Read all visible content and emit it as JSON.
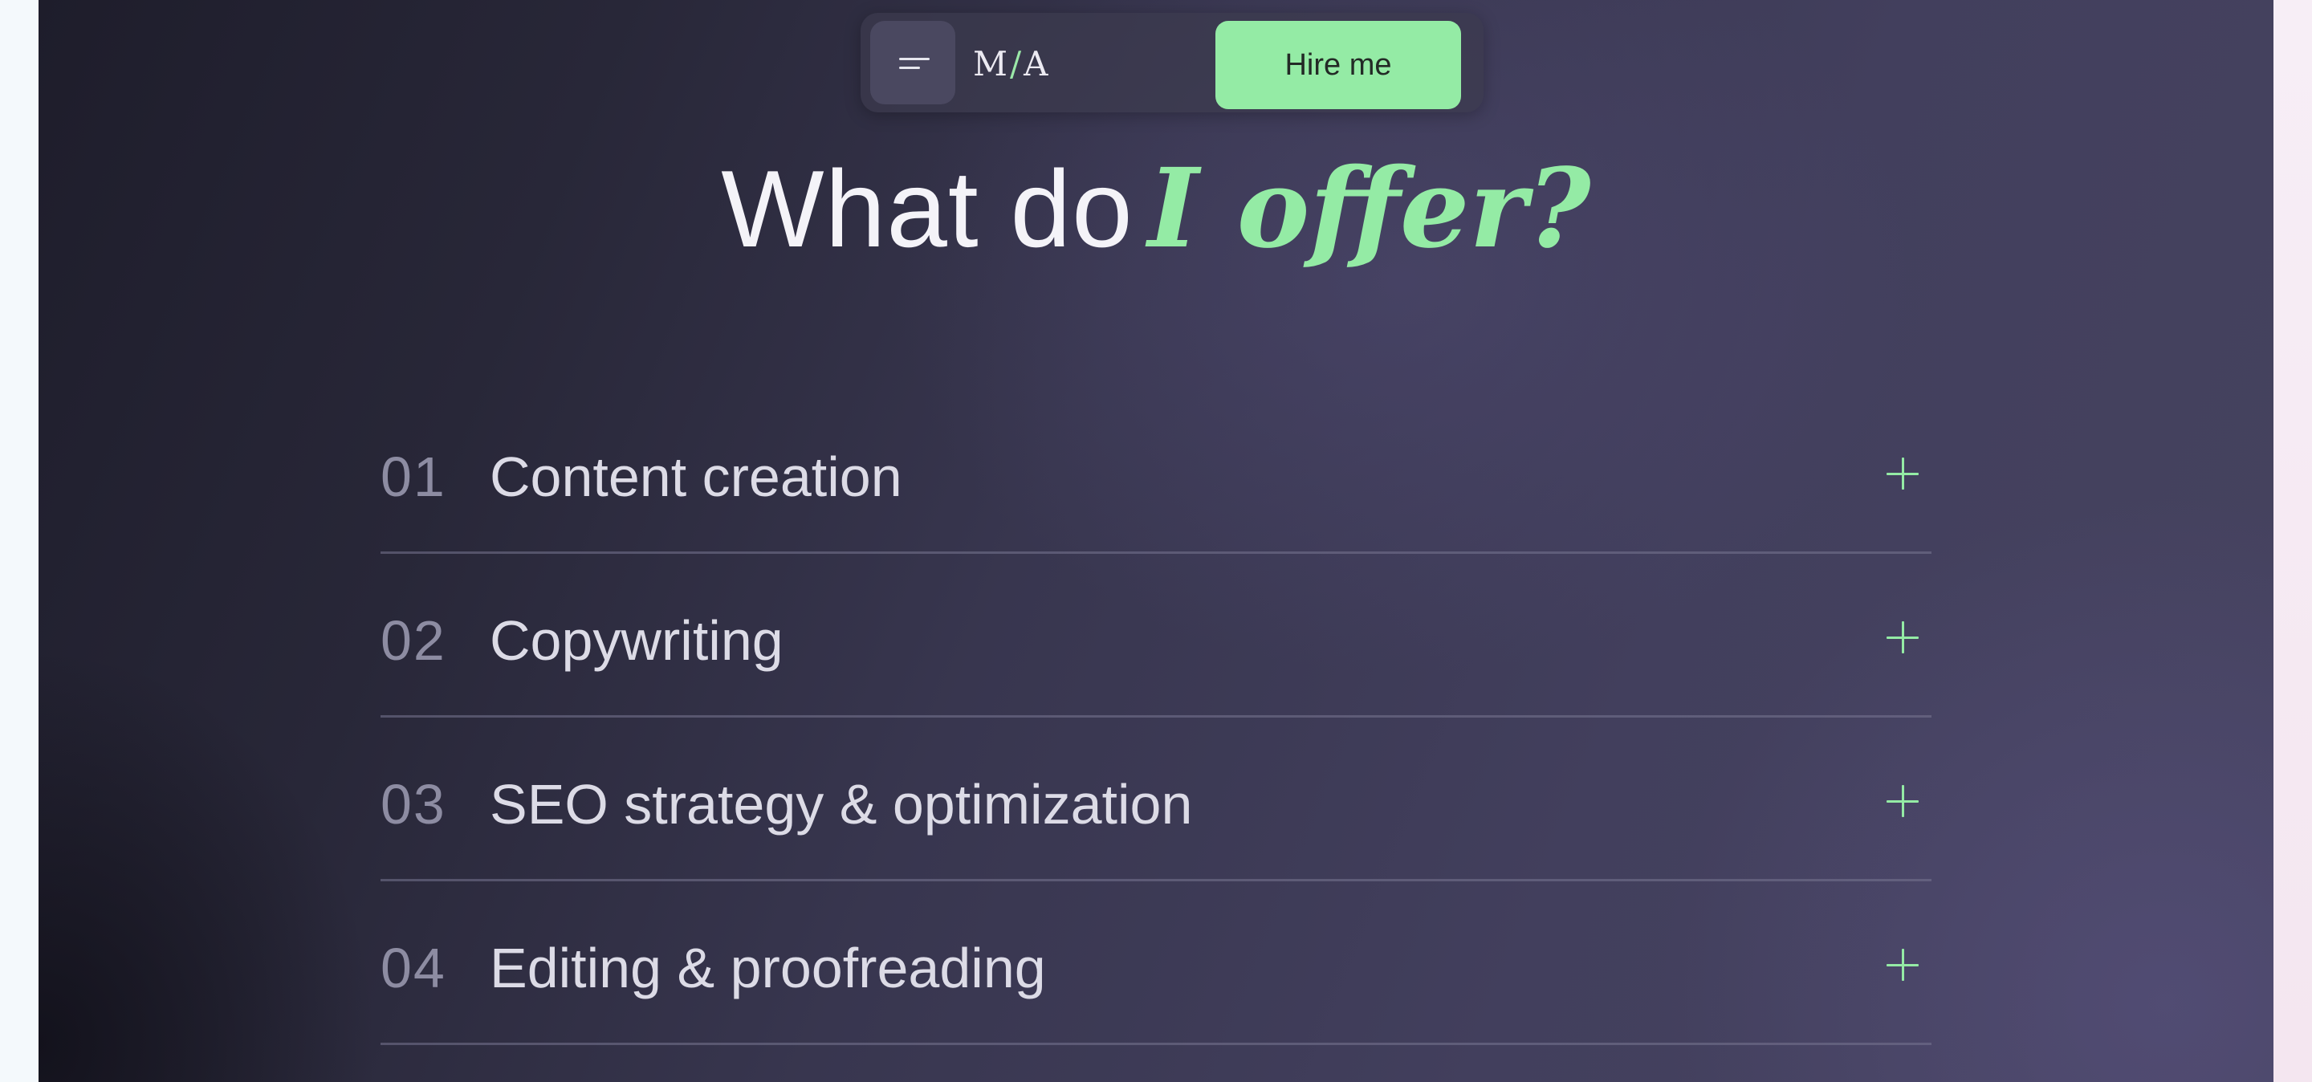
{
  "header": {
    "logo_left": "M",
    "logo_slash": "/",
    "logo_right": "A",
    "hire_label": "Hire me",
    "menu_icon": "menu-icon"
  },
  "hero": {
    "title_plain": "What do",
    "title_accent": "I offer?"
  },
  "services": [
    {
      "num": "01",
      "label": "Content creation"
    },
    {
      "num": "02",
      "label": "Copywriting"
    },
    {
      "num": "03",
      "label": "SEO strategy & optimization"
    },
    {
      "num": "04",
      "label": "Editing & proofreading"
    }
  ],
  "colors": {
    "accent": "#94eba5",
    "panel_dark": "#1e1d2b",
    "panel_mid": "#423f5d",
    "text_light": "#dcdbe6",
    "number_muted": "#8d8ca2"
  }
}
